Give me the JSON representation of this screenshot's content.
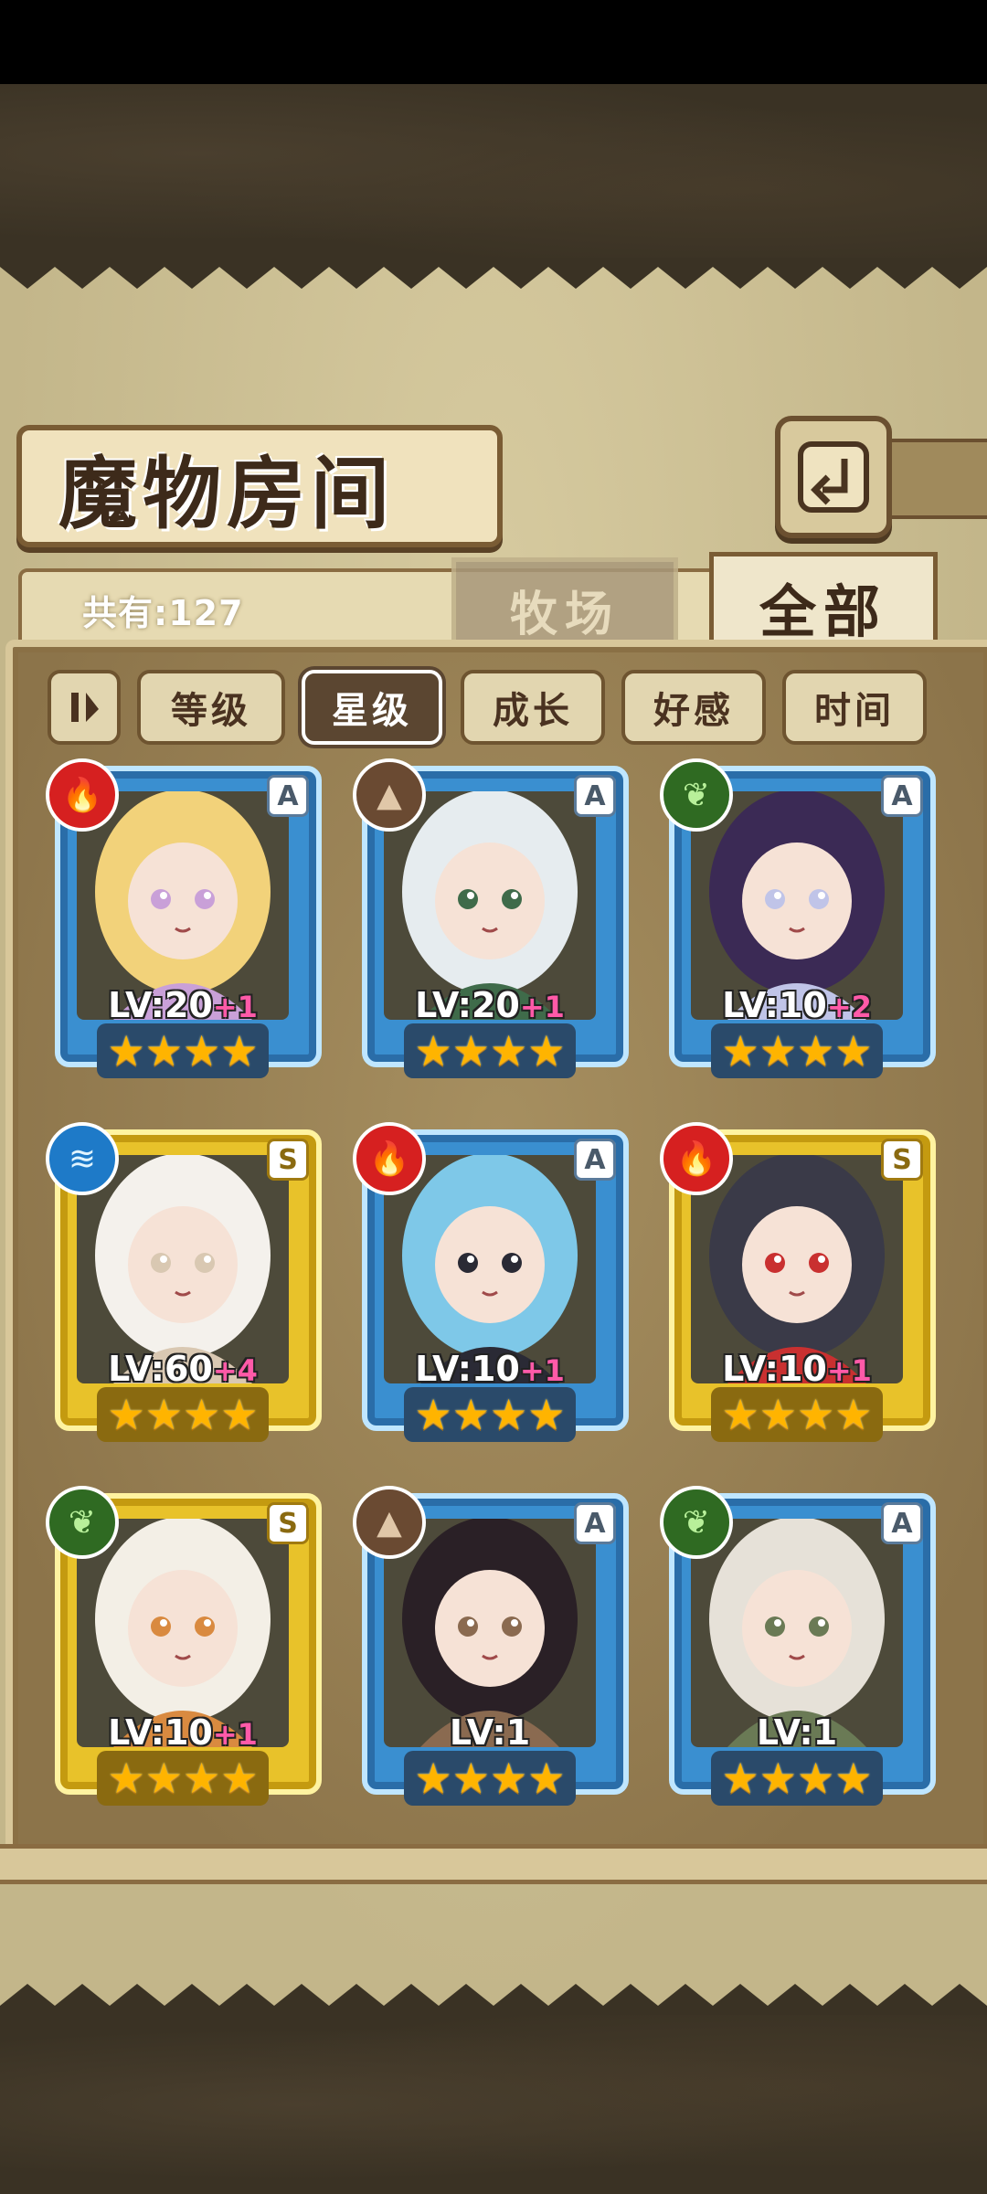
{
  "title": "魔物房间",
  "count_label": "共有:127",
  "tabs": {
    "ranch": "牧场",
    "all": "全部"
  },
  "sort": {
    "toggle_icon": "sort-order-icon",
    "level": "等级",
    "star": "星级",
    "growth": "成长",
    "affection": "好感",
    "time": "时间",
    "active": "星级"
  },
  "back_icon": "return-arrow-icon",
  "monsters": [
    {
      "level_base": "LV:20",
      "level_plus": "+1",
      "rank": "A",
      "element": "fire",
      "stars": "★★★★",
      "frame": "blue"
    },
    {
      "level_base": "LV:20",
      "level_plus": "+1",
      "rank": "A",
      "element": "earth",
      "stars": "★★★★",
      "frame": "blue"
    },
    {
      "level_base": "LV:10",
      "level_plus": "+2",
      "rank": "A",
      "element": "wood",
      "stars": "★★★★",
      "frame": "blue"
    },
    {
      "level_base": "LV:60",
      "level_plus": "+4",
      "rank": "S",
      "element": "water",
      "stars": "★★★★",
      "frame": "gold"
    },
    {
      "level_base": "LV:10",
      "level_plus": "+1",
      "rank": "A",
      "element": "fire",
      "stars": "★★★★",
      "frame": "blue"
    },
    {
      "level_base": "LV:10",
      "level_plus": "+1",
      "rank": "S",
      "element": "fire",
      "stars": "★★★★",
      "frame": "gold"
    },
    {
      "level_base": "LV:10",
      "level_plus": "+1",
      "rank": "S",
      "element": "wood",
      "stars": "★★★★",
      "frame": "gold"
    },
    {
      "level_base": "LV:1",
      "level_plus": "",
      "rank": "A",
      "element": "earth",
      "stars": "★★★★",
      "frame": "blue"
    },
    {
      "level_base": "LV:1",
      "level_plus": "",
      "rank": "A",
      "element": "wood",
      "stars": "★★★★",
      "frame": "blue"
    }
  ],
  "element_glyphs": {
    "fire": "🔥",
    "earth": "▲",
    "wood": "❦",
    "water": "≋"
  }
}
